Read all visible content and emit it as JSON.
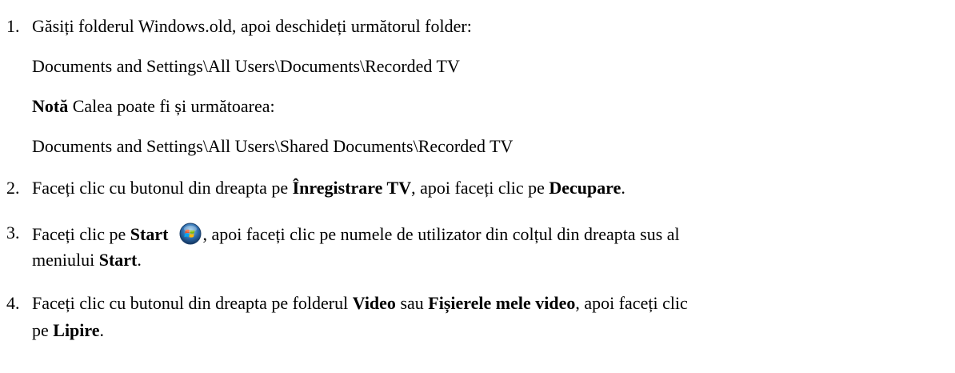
{
  "steps": [
    {
      "number": "1.",
      "intro": "Găsiți folderul Windows.old, apoi deschideți următorul folder:",
      "path": "Documents and Settings\\All Users\\Documents\\Recorded TV",
      "note_label": "Notă",
      "note_text": " Calea poate fi și următoarea:",
      "alt_path": "Documents and Settings\\All Users\\Shared Documents\\Recorded TV"
    },
    {
      "number": "2.",
      "t1": "Faceți clic cu butonul din dreapta pe ",
      "b1": "Înregistrare TV",
      "t2": ", apoi faceți clic pe ",
      "b2": "Decupare",
      "t3": "."
    },
    {
      "number": "3.",
      "t1": "Faceți clic pe ",
      "b1": "Start",
      "icon": "windows-start-orb-icon",
      "t2": ", apoi faceți clic pe numele de utilizator din colțul din dreapta sus al",
      "l2_t1": "meniului ",
      "l2_b1": "Start",
      "l2_t2": "."
    },
    {
      "number": "4.",
      "t1": "Faceți clic cu butonul din dreapta pe folderul ",
      "b1": "Video",
      "t2": " sau ",
      "b2": "Fișierele mele video",
      "t3": ", apoi faceți clic",
      "l2_t1": "pe ",
      "l2_b1": "Lipire",
      "l2_t2": "."
    }
  ],
  "colors": {
    "text": "#000000",
    "background": "#ffffff"
  }
}
